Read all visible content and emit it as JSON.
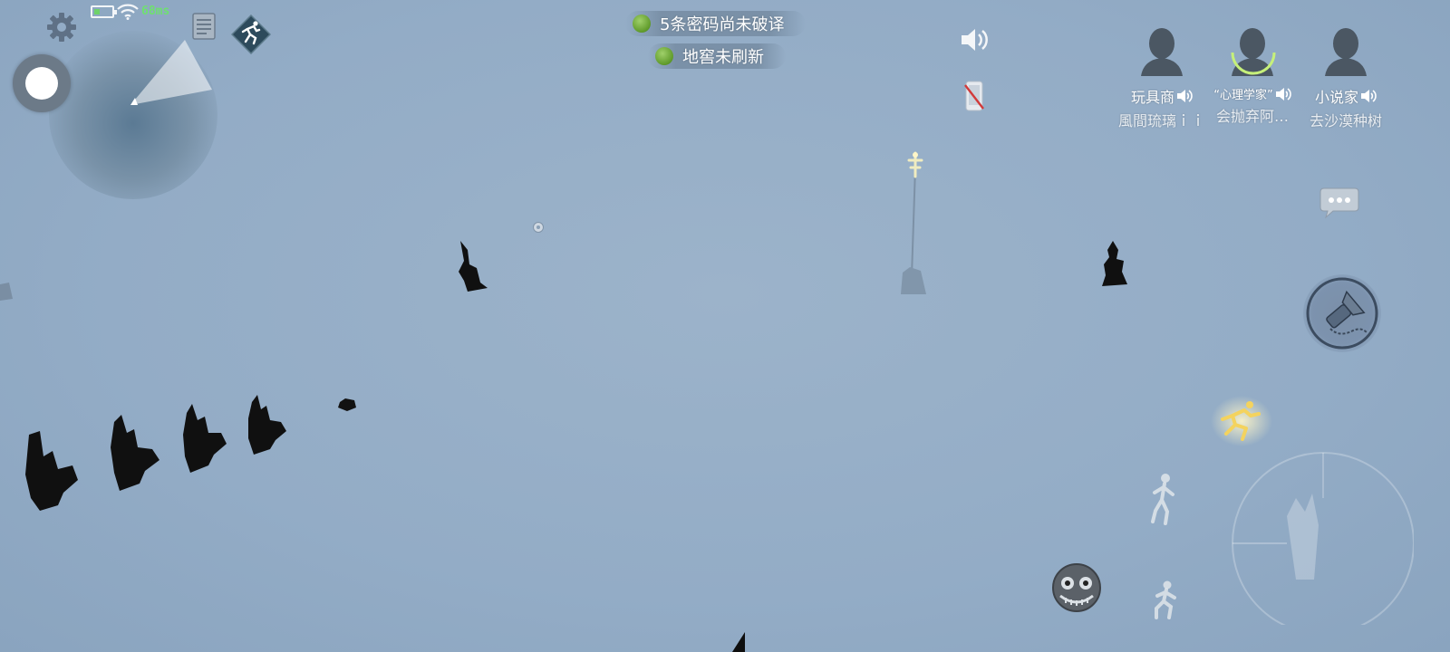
{
  "status": {
    "ping": "68ms",
    "battery_level": 0.35,
    "icons": [
      "gear-icon",
      "battery-icon",
      "wifi-icon",
      "notes-icon",
      "skill-diamond-icon"
    ]
  },
  "notices": {
    "ciphers": "5条密码尚未破译",
    "cellar": "地窖未刷新"
  },
  "teammates": [
    {
      "role": "玩具商",
      "player": "風間琉璃ｉｉ",
      "highlighted": false
    },
    {
      "role": "“心理学家”",
      "player": "会抛弃阿…",
      "highlighted": true
    },
    {
      "role": "小说家",
      "player": "去沙漠种树",
      "highlighted": false
    }
  ],
  "colors": {
    "accent_green": "#6fe070",
    "ring_green": "#c6f07a",
    "cipher_dot": "#7fb54a",
    "sky": "#93acc6"
  },
  "controls": [
    "chat-bubble-icon",
    "item-button",
    "sprint-icon",
    "action-arc",
    "skull-emote-icon",
    "speaker-icon",
    "phone-muted-icon"
  ]
}
